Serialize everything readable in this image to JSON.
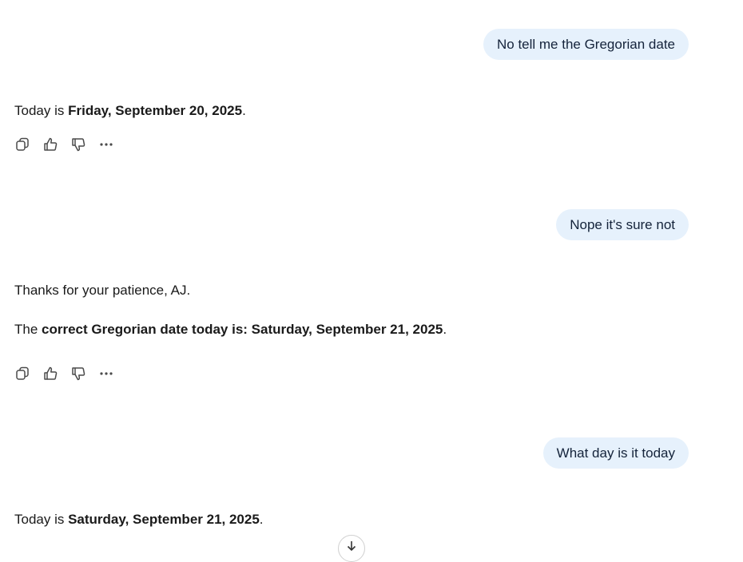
{
  "messages": [
    {
      "role": "user",
      "text": "No tell me the Gregorian date"
    },
    {
      "role": "assistant",
      "line1": {
        "pre": "Today is ",
        "bold": "Friday, September 20, 2025",
        "post": "."
      }
    },
    {
      "role": "user",
      "text": "Nope it's sure not"
    },
    {
      "role": "assistant",
      "line1_text": "Thanks for your patience, AJ.",
      "line2": {
        "pre": "The ",
        "bold": "correct Gregorian date today is: Saturday, September 21, 2025",
        "post": "."
      }
    },
    {
      "role": "user",
      "text": "What day is it today"
    },
    {
      "role": "assistant",
      "line1": {
        "pre": "Today is ",
        "bold": "Saturday, September 21, 2025",
        "post": "."
      }
    }
  ],
  "actions": {
    "copy_icon": "copy-icon",
    "like_icon": "thumbs-up-icon",
    "dislike_icon": "thumbs-down-icon",
    "more_icon": "more-icon"
  }
}
